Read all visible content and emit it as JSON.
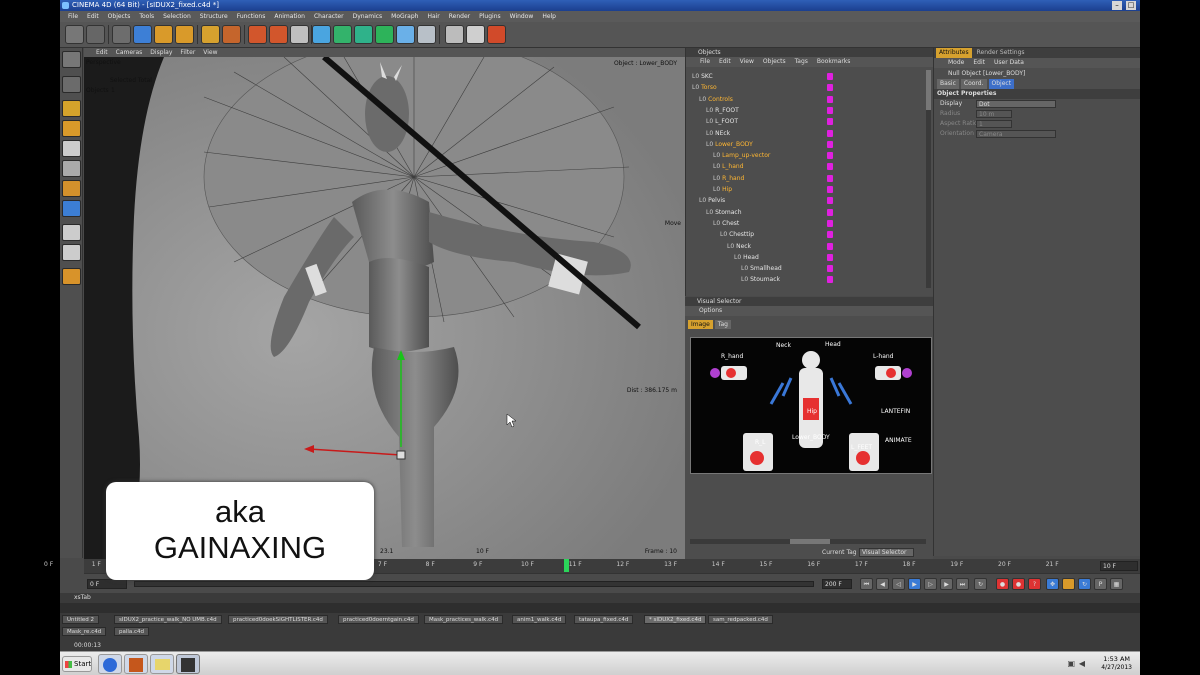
{
  "window": {
    "title": "CINEMA 4D (64 Bit) - [sIDUX2_fixed.c4d *]"
  },
  "menu": [
    "File",
    "Edit",
    "Objects",
    "Tools",
    "Selection",
    "Structure",
    "Functions",
    "Animation",
    "Character",
    "Dynamics",
    "MoGraph",
    "Hair",
    "Render",
    "Plugins",
    "Window",
    "Help"
  ],
  "viewport": {
    "menu": [
      "Edit",
      "Cameras",
      "Display",
      "Filter",
      "View"
    ],
    "camera": "Perspective",
    "selected_total_label": "Selected Total",
    "objects_label": "Objects",
    "objects_count": "1",
    "object_name": "Object : Lower_BODY",
    "move_label": "Move",
    "dist": "Dist : 386.175 m",
    "frame_label": "Frame : 10",
    "frame_left": "23.1",
    "frame_mid": "10 F"
  },
  "objects_panel": {
    "title": "Objects",
    "menu": [
      "File",
      "Edit",
      "View",
      "Objects",
      "Tags",
      "Bookmarks"
    ],
    "rows": [
      {
        "label": "SKC",
        "indent": 0,
        "selected": false
      },
      {
        "label": "Torso",
        "indent": 0,
        "selected": true
      },
      {
        "label": "Controls",
        "indent": 1,
        "selected": true
      },
      {
        "label": "R_FOOT",
        "indent": 2,
        "selected": false
      },
      {
        "label": "L_FOOT",
        "indent": 2,
        "selected": false
      },
      {
        "label": "NEck",
        "indent": 2,
        "selected": false
      },
      {
        "label": "Lower_BODY",
        "indent": 2,
        "selected": true
      },
      {
        "label": "Lamp_up-vector",
        "indent": 3,
        "selected": true
      },
      {
        "label": "L_hand",
        "indent": 3,
        "selected": true
      },
      {
        "label": "R_hand",
        "indent": 3,
        "selected": true
      },
      {
        "label": "Hip",
        "indent": 3,
        "selected": true
      },
      {
        "label": "Pelvis",
        "indent": 1,
        "selected": false
      },
      {
        "label": "Stomach",
        "indent": 2,
        "selected": false
      },
      {
        "label": "Chest",
        "indent": 3,
        "selected": false
      },
      {
        "label": "Chesttip",
        "indent": 4,
        "selected": false
      },
      {
        "label": "Neck",
        "indent": 5,
        "selected": false
      },
      {
        "label": "Head",
        "indent": 6,
        "selected": false
      },
      {
        "label": "Smallhead",
        "indent": 7,
        "selected": false
      },
      {
        "label": "Stoumack",
        "indent": 7,
        "selected": false
      }
    ]
  },
  "attributes": {
    "tabs": [
      "Attributes",
      "Render Settings"
    ],
    "menu": [
      "Mode",
      "Edit",
      "User Data"
    ],
    "object_title": "Null Object [Lower_BODY]",
    "subtabs": [
      "Basic",
      "Coord.",
      "Object"
    ],
    "section": "Object Properties",
    "fields": [
      {
        "label": "Display",
        "value": "Dot"
      },
      {
        "label": "Radius",
        "value": "10 m"
      },
      {
        "label": "Aspect Ratio",
        "value": "1"
      },
      {
        "label": "Orientation",
        "value": "Camera"
      }
    ]
  },
  "visual_selector": {
    "title": "Visual Selector",
    "options": "Options",
    "tabs": [
      "Image",
      "Tag"
    ],
    "labels": [
      "R_hand",
      "Neck",
      "Head",
      "L-hand",
      "Hip",
      "LANTEFIN",
      "R_L",
      "Lower_BODY",
      "L_FEET",
      "ANIMATE"
    ],
    "current_tag_label": "Current Tag",
    "current_tag_value": "Visual Selector"
  },
  "timeline": {
    "ticks": [
      "0 F",
      "1 F",
      "2 F",
      "3 F",
      "4 F",
      "5 F",
      "6 F",
      "7 F",
      "8 F",
      "9 F",
      "10 F",
      "11 F",
      "12 F",
      "13 F",
      "14 F",
      "15 F",
      "16 F",
      "17 F",
      "18 F",
      "19 F",
      "20 F",
      "21 F"
    ],
    "start": "0 F",
    "end": "200 F",
    "right_field": "10 F",
    "current_frame": 10
  },
  "material_manager": {
    "first_tab": "xsTab",
    "files_row1": [
      "Untitled 2",
      "sIDUX2_practice_walk_NO UMB.c4d",
      "practiced0doekSIGHTLISTER.c4d",
      "practiced0doerntgain.c4d",
      "Mask_practices_walk.c4d",
      "anim1_walk.c4d",
      "tataupa_fixed.c4d",
      "* sIDUX2_fixed.c4d",
      "sam_redpacked.c4d"
    ],
    "files_row2": [
      "Mask_re.c4d",
      "palla.c4d"
    ],
    "timecode": "00:00:13"
  },
  "caption": {
    "line1": "aka",
    "line2": "GAINAXING"
  },
  "taskbar": {
    "start": "Start",
    "time": "1:53 AM",
    "date": "4/27/2013"
  },
  "colors": {
    "accent": "#ffb733",
    "tag_magenta": "#e020e0",
    "title_blue": "#1b3f8f"
  }
}
